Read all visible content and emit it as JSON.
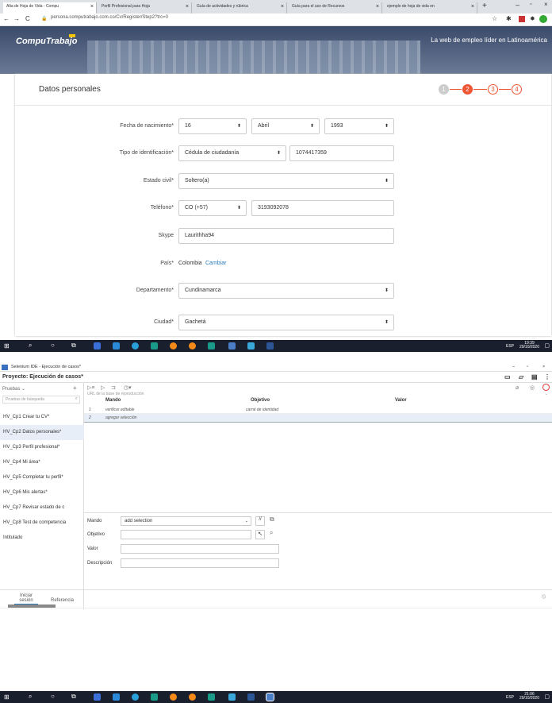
{
  "browser": {
    "tabs": [
      "Alta de Hoja de Vida - Compu",
      "Perfil Profesional para Hoja",
      "Guía de actividades y rúbrica",
      "Guía para el uso de Recursos",
      "ejemplo de hoja de vida en"
    ],
    "url": "persona.computrabajo.com.co/Cv/Register/Step2?trc=0"
  },
  "site": {
    "logo": "CompuTrabajo",
    "slogan": "La web de empleo líder en Latinoamérica",
    "card_title": "Datos personales",
    "steps": [
      "1",
      "2",
      "3",
      "4"
    ]
  },
  "form": {
    "birth_label": "Fecha de nacimiento*",
    "birth_day": "16",
    "birth_month": "Abril",
    "birth_year": "1993",
    "id_label": "Tipo de identificación*",
    "id_type": "Cédula de ciudadanía",
    "id_number": "1074417359",
    "civil_label": "Estado civil*",
    "civil": "Soltero(a)",
    "phone_label": "Teléfono*",
    "phone_code": "CO (+57)",
    "phone_number": "3193092078",
    "skype_label": "Skype",
    "skype": "Laurithha94",
    "country_label": "País*",
    "country": "Colombia",
    "country_change": "Cambiar",
    "dept_label": "Departamento*",
    "dept": "Cundinamarca",
    "city_label": "Ciudad*",
    "city": "Gachetá"
  },
  "taskbar1": {
    "time": "19:39",
    "date": "29/10/2020",
    "lang": "ESP"
  },
  "selenium": {
    "window_title": "Selenium IDE - Ejecución de casos*",
    "project": "Proyecto: Ejecución de casos*",
    "tests_label": "Pruebas",
    "search_placeholder": "Pruebas de búsqueda",
    "base_url_placeholder": "URL de la base de reproducción",
    "tests": [
      "HV_Cp1 Crear tu CV*",
      "HV_Cp2 Datos personales*",
      "HV_Cp3 Perfil profesional*",
      "HV_Cp4 Mi área*",
      "HV_Cp5 Completar tu perfil*",
      "HV_Cp6 Mis alertas*",
      "HV_Cp7 Revisar estado de c",
      "HV_Cp8 Test de competencia",
      "Intitulado"
    ],
    "col_command": "Mando",
    "col_target": "Objetivo",
    "col_value": "Valor",
    "rows": [
      {
        "num": "1",
        "command": "verificar editable",
        "target": "carné de identidad",
        "value": ""
      },
      {
        "num": "2",
        "command": "agregar selección",
        "target": "",
        "value": ""
      }
    ],
    "cmd_label": "Mando",
    "cmd_value": "add selection",
    "target_label": "Objetivo",
    "value_label": "Valor",
    "desc_label": "Descripción",
    "log_tab": "Iniciar sesión",
    "ref_tab": "Referencia"
  },
  "taskbar2": {
    "time": "21:06",
    "date": "29/10/2020",
    "lang": "ESP"
  }
}
